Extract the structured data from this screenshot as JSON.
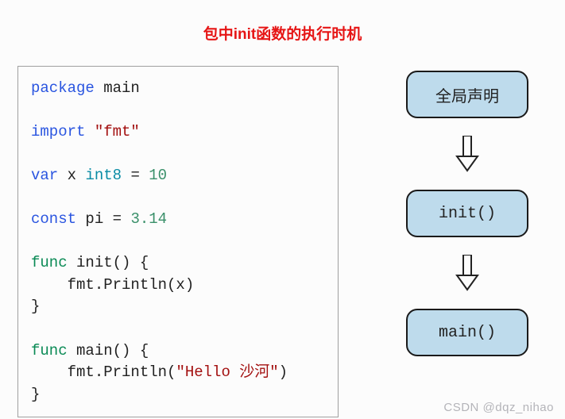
{
  "title": "包中init函数的执行时机",
  "code": {
    "l1_kw": "package",
    "l1_name": " main",
    "l2_kw": "import",
    "l2_str": " \"fmt\"",
    "l3_kw": "var",
    "l3_name": " x ",
    "l3_type": "int8",
    "l3_eq": " = ",
    "l3_val": "10",
    "l4_kw": "const",
    "l4_name": " pi ",
    "l4_eq": "= ",
    "l4_val": "3.14",
    "l5_kw": "func",
    "l5_sig": " init() {",
    "l6": "    fmt.Println(x)",
    "l7": "}",
    "l8_kw": "func",
    "l8_sig": " main() {",
    "l9a": "    fmt.Println(",
    "l9b": "\"Hello 沙河\"",
    "l9c": ")",
    "l10": "}"
  },
  "flow": {
    "box1": "全局声明",
    "box2": "init()",
    "box3": "main()"
  },
  "watermark": "CSDN @dqz_nihao"
}
